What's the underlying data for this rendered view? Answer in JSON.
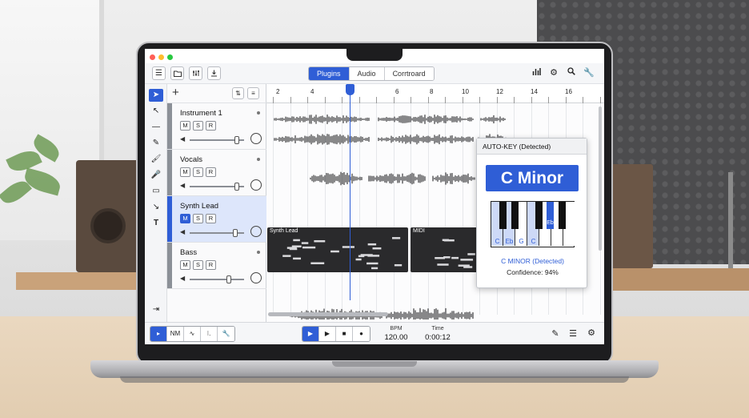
{
  "toolbar": {
    "left_icons": [
      "menu-icon",
      "folder-icon",
      "mixer-icon",
      "download-icon"
    ],
    "tabs": [
      {
        "label": "Plugins",
        "active": true
      },
      {
        "label": "Audio",
        "active": false
      },
      {
        "label": "Corrtroard",
        "active": false
      }
    ],
    "right_icons": [
      "bars-icon",
      "gear-icon",
      "search-icon",
      "wrench-icon"
    ]
  },
  "tools": [
    "pointer",
    "arrow",
    "line",
    "pencil",
    "brush",
    "mic",
    "clip",
    "curve",
    "text",
    "exit"
  ],
  "track_header": {
    "add": "+"
  },
  "tracks": [
    {
      "name": "Instrument 1",
      "mute": "M",
      "solo": "S",
      "record": "R",
      "selected": false,
      "volume": 0.82
    },
    {
      "name": "Vocals",
      "mute": "M",
      "solo": "S",
      "record": "R",
      "selected": false,
      "volume": 0.82
    },
    {
      "name": "Synth Lead",
      "mute": "M",
      "solo": "S",
      "record": "R",
      "selected": true,
      "mute_on": true,
      "volume": 0.8
    },
    {
      "name": "Bass",
      "mute": "M",
      "solo": "S",
      "record": "R",
      "selected": false,
      "volume": 0.72
    }
  ],
  "ruler": {
    "labels": [
      "2",
      "4",
      "6",
      "8",
      "10",
      "12",
      "14",
      "16"
    ]
  },
  "clips": {
    "synth_lead": "Synth Lead",
    "midi": "MIDI"
  },
  "bottom": {
    "tool_buttons": [
      "▸",
      "NM",
      "∿",
      "⁝.",
      "🔧"
    ],
    "transport": [
      "▶",
      "▶",
      "■",
      "●"
    ],
    "bpm_label": "BPM",
    "bpm_value": "120.00",
    "time_label": "Time",
    "time_value": "0:00:12"
  },
  "autokey": {
    "title": "AUTO-KEY (Detected)",
    "key": "C Minor",
    "labels": {
      "c": "C",
      "eb_white": "Eb",
      "g": "G",
      "c2": "C",
      "eb_black": "Eb"
    },
    "result": "C MINOR (Detected)",
    "confidence": "Confidence: 94%"
  },
  "colors": {
    "accent": "#2f5ed6",
    "clip": "#2a2a2c",
    "waveform": "#3a3a3c"
  }
}
